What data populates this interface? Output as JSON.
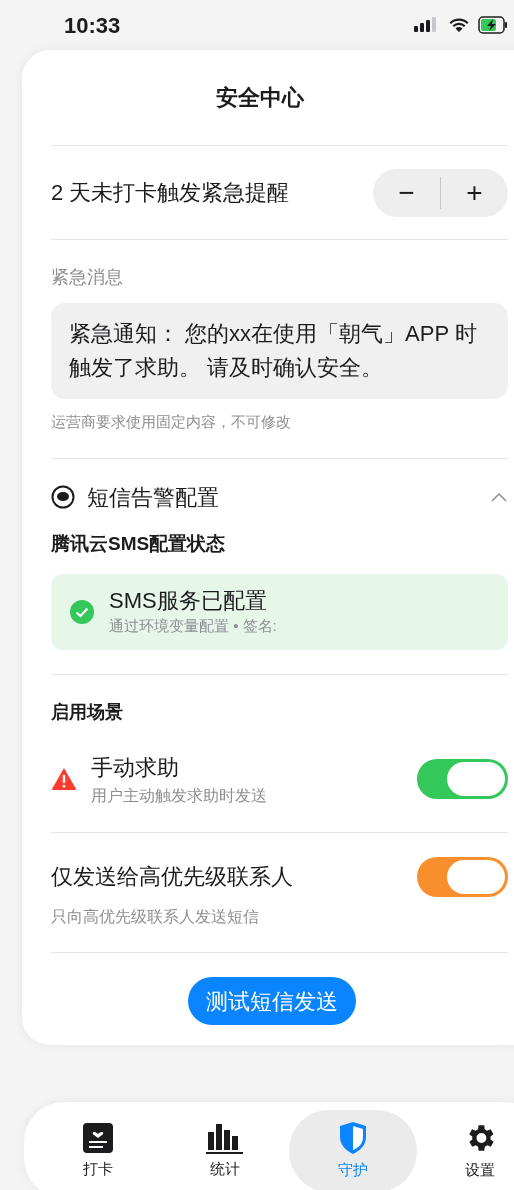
{
  "status_bar": {
    "time": "10:33"
  },
  "header": {
    "title": "安全中心"
  },
  "threshold": {
    "label": "2 天未打卡触发紧急提醒",
    "decrement": "−",
    "increment": "+"
  },
  "message": {
    "label": "紧急消息",
    "text": "紧急通知： 您的xx在使用「朝气」APP 时触发了求助。 请及时确认安全。",
    "note": "运营商要求使用固定内容，不可修改"
  },
  "sms": {
    "title": "短信告警配置",
    "expanded": true,
    "provider_label": "腾讯云SMS配置状态",
    "status": {
      "configured": true,
      "title": "SMS服务已配置",
      "detail": "通过环境变量配置 • 签名:"
    }
  },
  "scenarios": {
    "label": "启用场景",
    "items": [
      {
        "kind": "alert",
        "title": "手动求助",
        "subtitle": "用户主动触发求助时发送",
        "on": true,
        "color": "#34c759"
      },
      {
        "kind": "plain",
        "title": "仅发送给高优先级联系人",
        "subtitle": "只向高优先级联系人发送短信",
        "on": true,
        "color": "#f98e2d"
      }
    ]
  },
  "test_button": "测试短信发送",
  "tab_bar": [
    {
      "kind": "checkin",
      "label": "打卡",
      "selected": false
    },
    {
      "kind": "stats",
      "label": "统计",
      "selected": false
    },
    {
      "kind": "guard",
      "label": "守护",
      "selected": true
    },
    {
      "kind": "settings",
      "label": "设置",
      "selected": false
    }
  ]
}
